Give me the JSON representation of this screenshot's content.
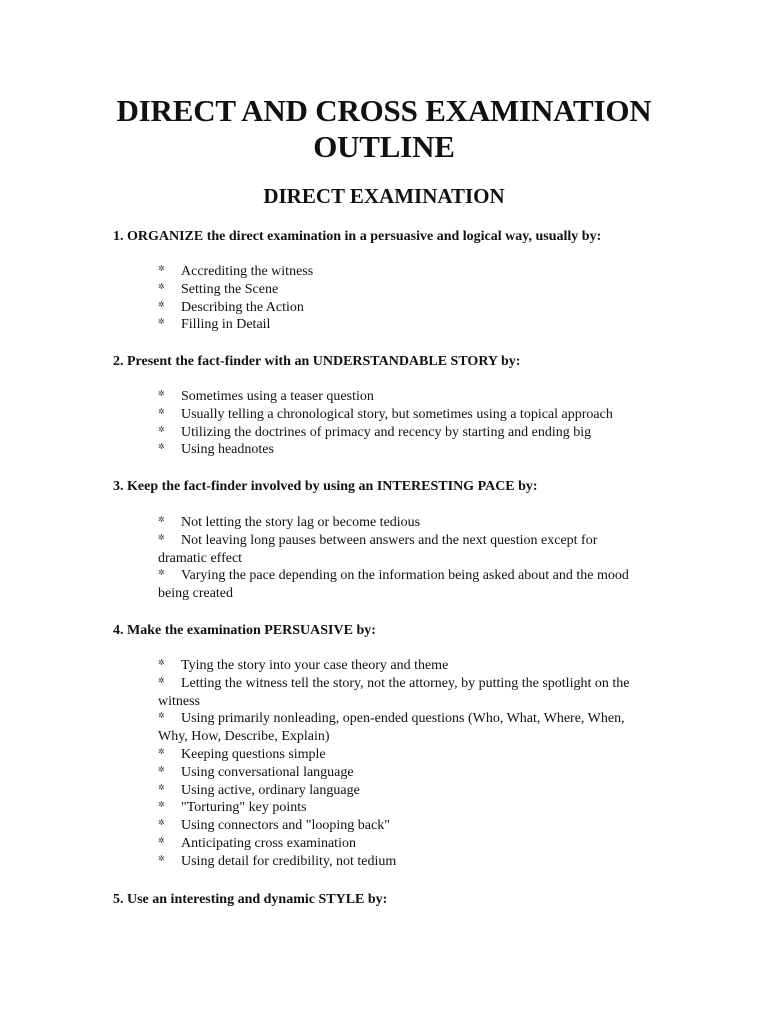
{
  "document": {
    "title_line1": "DIRECT AND CROSS EXAMINATION",
    "title_line2": "OUTLINE",
    "subtitle": "DIRECT EXAMINATION",
    "bullet_icon": "✲",
    "sections": [
      {
        "heading": "1. ORGANIZE the direct examination in a persuasive and logical way, usually by:",
        "items": [
          "Accrediting the witness",
          "Setting the Scene",
          "Describing the Action",
          "Filling in Detail"
        ]
      },
      {
        "heading": "2. Present the fact-finder with an UNDERSTANDABLE STORY by:",
        "items": [
          "Sometimes using a teaser question",
          "Usually telling a chronological story, but sometimes using a topical approach",
          "Utilizing the doctrines of primacy and recency by starting and ending big",
          "Using headnotes"
        ]
      },
      {
        "heading": "3. Keep the fact-finder involved by using an INTERESTING PACE by:",
        "items": [
          "Not letting the story lag or become tedious",
          "Not leaving long pauses between answers and the next question except for dramatic effect",
          "Varying the pace depending on the information being asked about and the mood being created"
        ]
      },
      {
        "heading": "4. Make the examination PERSUASIVE by:",
        "items": [
          "Tying the story into your case theory and theme",
          "Letting the witness tell the story, not the attorney, by putting the spotlight on the witness",
          "Using primarily nonleading, open-ended questions (Who, What, Where, When, Why, How, Describe, Explain)",
          "Keeping questions simple",
          "Using conversational language",
          "Using active, ordinary language",
          "\"Torturing\" key points",
          "Using connectors and \"looping back\"",
          "Anticipating cross examination",
          "Using detail for credibility, not tedium"
        ]
      },
      {
        "heading": "5. Use an interesting and dynamic STYLE by:",
        "items": []
      }
    ]
  }
}
